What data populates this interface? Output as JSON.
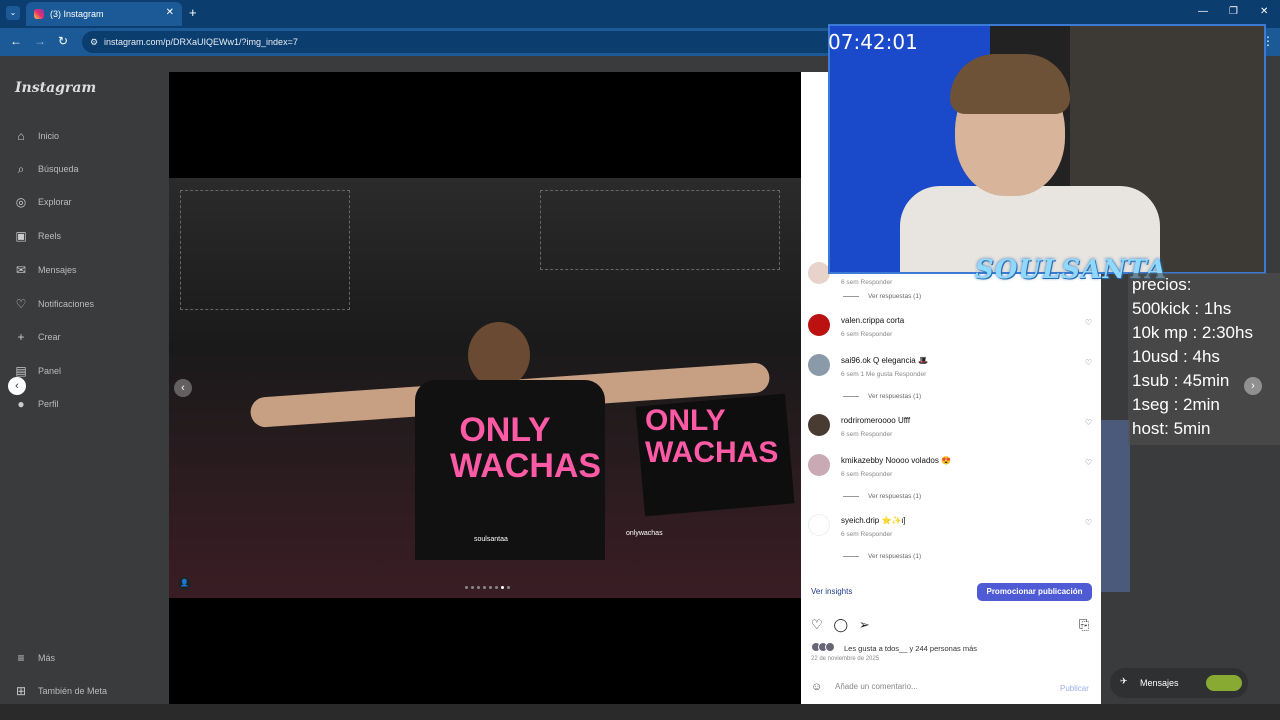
{
  "browser": {
    "tab_title": "(3) Instagram",
    "new_tab_glyph": "+",
    "close_tab_glyph": "✕",
    "url": "instagram.com/p/DRXaUIQEWw1/?img_index=7"
  },
  "sidebar": {
    "logo": "Instagram",
    "items": [
      {
        "label": "Inicio",
        "icon": "home-icon"
      },
      {
        "label": "Búsqueda",
        "icon": "search-icon"
      },
      {
        "label": "Explorar",
        "icon": "compass-icon"
      },
      {
        "label": "Reels",
        "icon": "reels-icon"
      },
      {
        "label": "Mensajes",
        "icon": "messenger-icon"
      },
      {
        "label": "Notificaciones",
        "icon": "heart-icon"
      },
      {
        "label": "Crear",
        "icon": "plus-icon"
      },
      {
        "label": "Panel",
        "icon": "chart-icon"
      },
      {
        "label": "Perfil",
        "icon": "avatar-icon"
      }
    ],
    "more": "Más",
    "meta": "También de Meta"
  },
  "post": {
    "shirt_text": "ONLY\nWACHAS",
    "tags": [
      "soulsantaa",
      "onlywachas"
    ],
    "carousel_count": 8,
    "carousel_active": 7
  },
  "comments": [
    {
      "user": "",
      "text": "",
      "meta": "6 sem   Responder",
      "replies": "Ver respuestas (1)"
    },
    {
      "user": "valen.crippa",
      "text": "corta",
      "meta": "6 sem   Responder"
    },
    {
      "user": "sai96.ok",
      "text": "Q elegancia 🎩",
      "meta": "6 sem   1 Me gusta   Responder",
      "replies": "Ver respuestas (1)"
    },
    {
      "user": "rodriromeroooo",
      "text": "Ufff",
      "meta": "6 sem   Responder"
    },
    {
      "user": "kmikazebby",
      "text": "Noooo volados 😍",
      "meta": "6 sem   Responder",
      "replies": "Ver respuestas (1)"
    },
    {
      "user": "syeich.drip",
      "text": "⭐✨ι]",
      "meta": "6 sem   Responder",
      "replies": "Ver respuestas (1)"
    }
  ],
  "panel": {
    "insights": "Ver insights",
    "promote": "Promocionar publicación",
    "likes_text": "Les gusta a tdos__ y 244 personas más",
    "date": "22 de noviembre de 2025",
    "add_comment": "Añade un comentario...",
    "publish": "Publicar"
  },
  "overlay": {
    "clock": "07:42:01",
    "brand": "SOULSANTA",
    "prices_title": "precios:",
    "prices": [
      "500kick : 1hs",
      "10k mp : 2:30hs",
      "10usd : 4hs",
      "1sub : 45min",
      "1seg : 2min",
      "host: 5min"
    ]
  },
  "messages_pill": "Mensajes",
  "colors": {
    "accent": "#4f5bd5",
    "pink": "#ff5aa5",
    "chrome": "#1b5a96"
  }
}
